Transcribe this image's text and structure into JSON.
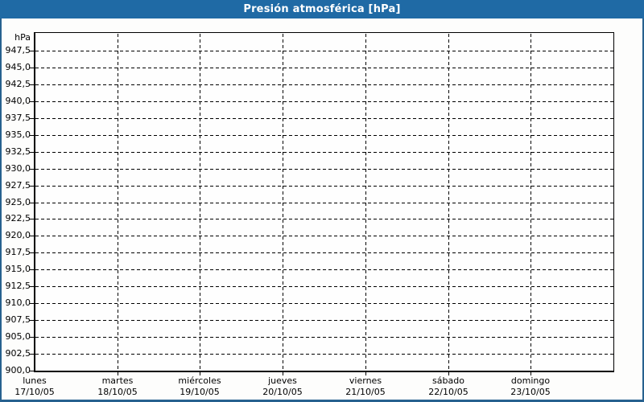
{
  "header": {
    "title": "Presión atmosférica [hPa]"
  },
  "colors": {
    "header_bg": "#1f6aa5",
    "header_text": "#ffffff",
    "frame_border": "#27618f",
    "canvas_bg": "#fdfdfc",
    "plot_bg": "#fefefe",
    "grid": "#000000",
    "axis": "#000000",
    "text": "#000000"
  },
  "chart_data": {
    "type": "line",
    "title": "Presión atmosférica [hPa]",
    "ylabel": "hPa",
    "xlabel": "",
    "ylim": [
      900,
      950
    ],
    "y_tick_step": 2.5,
    "grid": "dashed",
    "legend": "none",
    "y_ticks": [
      {
        "value": 947.5,
        "label": "947,5"
      },
      {
        "value": 945.0,
        "label": "945,0"
      },
      {
        "value": 942.5,
        "label": "942,5"
      },
      {
        "value": 940.0,
        "label": "940,0"
      },
      {
        "value": 937.5,
        "label": "937,5"
      },
      {
        "value": 935.0,
        "label": "935,0"
      },
      {
        "value": 932.5,
        "label": "932,5"
      },
      {
        "value": 930.0,
        "label": "930,0"
      },
      {
        "value": 927.5,
        "label": "927,5"
      },
      {
        "value": 925.0,
        "label": "925,0"
      },
      {
        "value": 922.5,
        "label": "922,5"
      },
      {
        "value": 920.0,
        "label": "920,0"
      },
      {
        "value": 917.5,
        "label": "917,5"
      },
      {
        "value": 915.0,
        "label": "915,0"
      },
      {
        "value": 912.5,
        "label": "912,5"
      },
      {
        "value": 910.0,
        "label": "910,0"
      },
      {
        "value": 907.5,
        "label": "907,5"
      },
      {
        "value": 905.0,
        "label": "905,0"
      },
      {
        "value": 902.5,
        "label": "902,5"
      },
      {
        "value": 900.0,
        "label": "900,0"
      }
    ],
    "x_days": [
      {
        "name": "lunes",
        "date": "17/10/05"
      },
      {
        "name": "martes",
        "date": "18/10/05"
      },
      {
        "name": "miércoles",
        "date": "19/10/05"
      },
      {
        "name": "jueves",
        "date": "20/10/05"
      },
      {
        "name": "viernes",
        "date": "21/10/05"
      },
      {
        "name": "sábado",
        "date": "22/10/05"
      },
      {
        "name": "domingo",
        "date": "23/10/05"
      }
    ],
    "series": []
  }
}
